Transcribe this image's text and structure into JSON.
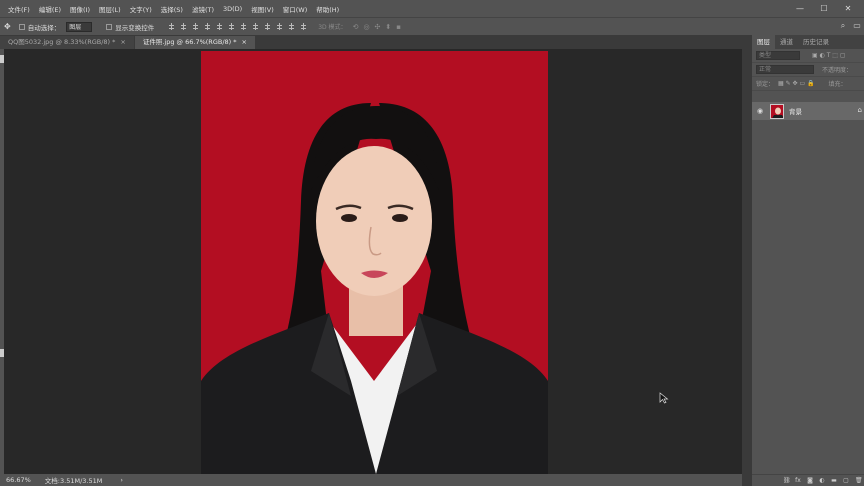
{
  "menubar": {
    "items": [
      "文件(F)",
      "编辑(E)",
      "图像(I)",
      "图层(L)",
      "文字(Y)",
      "选择(S)",
      "滤镜(T)",
      "3D(D)",
      "视图(V)",
      "窗口(W)",
      "帮助(H)"
    ],
    "minimize": "—",
    "maximize": "☐",
    "close": "✕"
  },
  "options": {
    "auto_select_label": "自动选择：",
    "auto_select_value": "图层",
    "show_transform_label": "显示变换控件",
    "mode_3d_label": "3D 模式："
  },
  "tabs": [
    {
      "label": "QQ图5032.jpg @ 8.33%(RGB/8) *",
      "close": "×"
    },
    {
      "label": "证件照.jpg @ 66.7%(RGB/8) *",
      "close": "×"
    }
  ],
  "panel": {
    "tabs": [
      "图层",
      "通道",
      "历史记录"
    ],
    "kind_placeholder": "类型",
    "blend_mode": "正常",
    "opacity_label": "不透明度：",
    "lock_label": "锁定：",
    "fill_label": "填充：",
    "layer_name": "背景"
  },
  "status": {
    "zoom": "66.67%",
    "doc_info": "文档:3.51M/3.51M",
    "arrow": "›"
  },
  "colors": {
    "background_red": "#b30e22",
    "suit": "#1c1c1e",
    "shirt": "#f2f2f2",
    "hair": "#121010",
    "skin": "#f0cdb8"
  }
}
